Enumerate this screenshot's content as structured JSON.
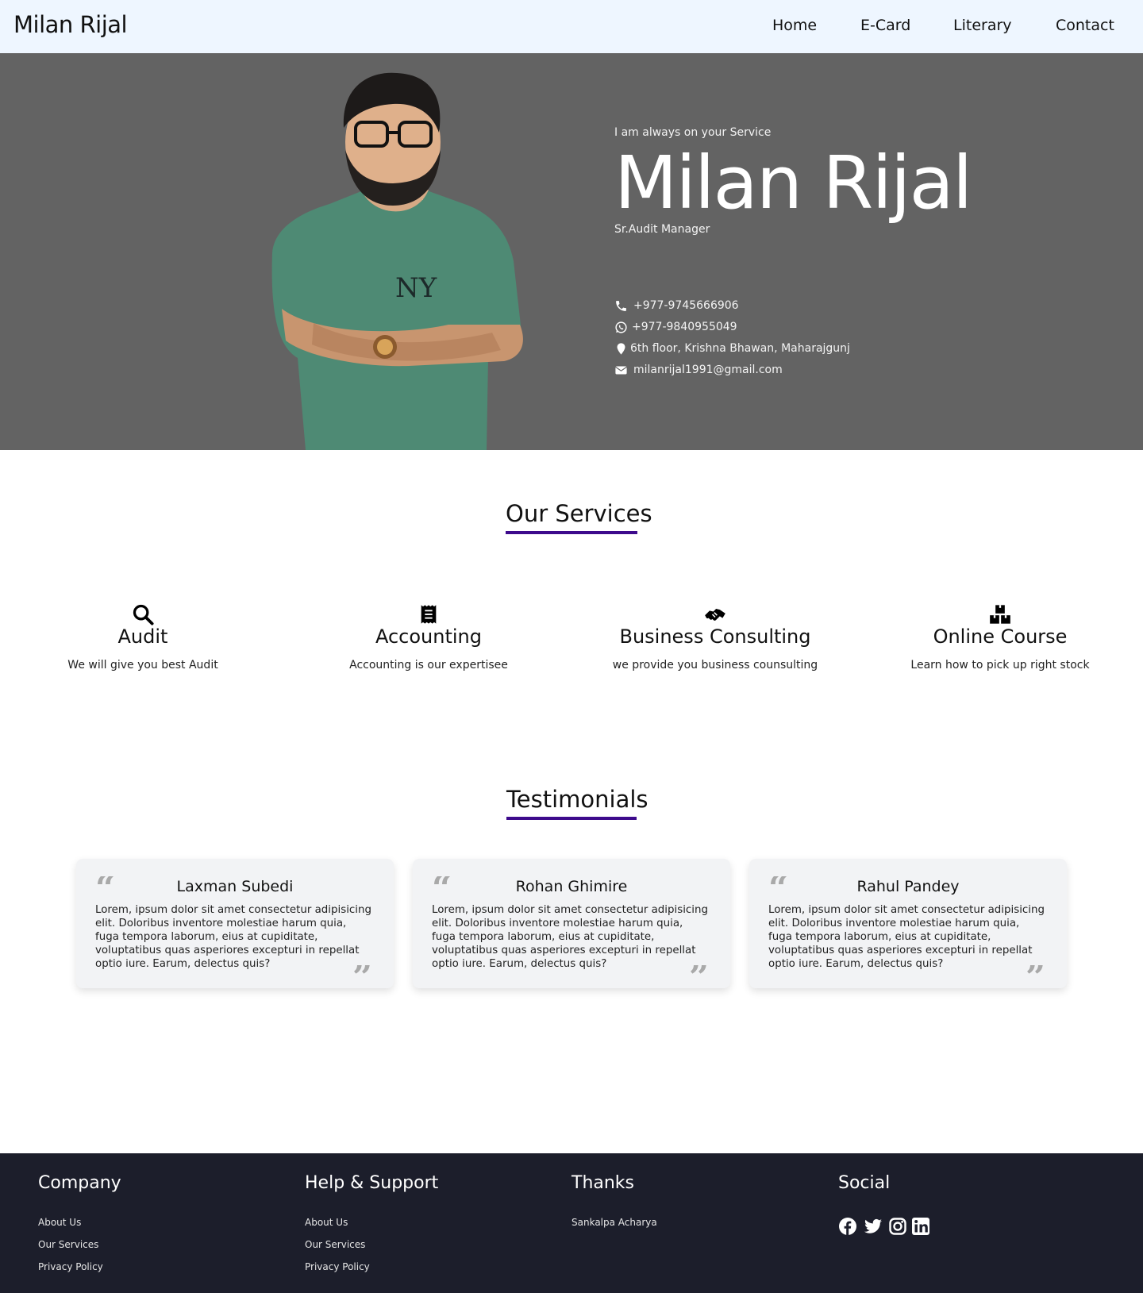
{
  "nav": {
    "brand": "Milan Rijal",
    "links": [
      "Home",
      "E-Card",
      "Literary",
      "Contact"
    ]
  },
  "hero": {
    "tagline": "I am always on your Service",
    "name": "Milan Rijal",
    "role": "Sr.Audit Manager",
    "contacts": [
      {
        "icon": "phone-icon",
        "text": "+977-9745666906"
      },
      {
        "icon": "whatsapp-icon",
        "text": "+977-9840955049"
      },
      {
        "icon": "location-pin-icon",
        "text": "6th floor, Krishna Bhawan, Maharajgunj"
      },
      {
        "icon": "envelope-icon",
        "text": "milanrijal1991@gmail.com"
      }
    ]
  },
  "services": {
    "title": "Our Services",
    "items": [
      {
        "icon": "search-icon",
        "title": "Audit",
        "desc": "We will give you best Audit"
      },
      {
        "icon": "receipt-icon",
        "title": "Accounting",
        "desc": "Accounting is our expertisee"
      },
      {
        "icon": "handshake-icon",
        "title": "Business Consulting",
        "desc": "we provide you business counsulting"
      },
      {
        "icon": "boxes-icon",
        "title": "Online Course",
        "desc": "Learn how to pick up right stock"
      }
    ]
  },
  "testimonials": {
    "title": "Testimonials",
    "items": [
      {
        "name": "Laxman Subedi",
        "text": "Lorem, ipsum dolor sit amet consectetur adipisicing elit. Doloribus inventore molestiae harum quia, fuga tempora laborum, eius at cupiditate, voluptatibus quas asperiores excepturi in repellat optio iure. Earum, delectus quis?"
      },
      {
        "name": "Rohan Ghimire",
        "text": "Lorem, ipsum dolor sit amet consectetur adipisicing elit. Doloribus inventore molestiae harum quia, fuga tempora laborum, eius at cupiditate, voluptatibus quas asperiores excepturi in repellat optio iure. Earum, delectus quis?"
      },
      {
        "name": "Rahul Pandey",
        "text": "Lorem, ipsum dolor sit amet consectetur adipisicing elit. Doloribus inventore molestiae harum quia, fuga tempora laborum, eius at cupiditate, voluptatibus quas asperiores excepturi in repellat optio iure. Earum, delectus quis?"
      }
    ]
  },
  "footer": {
    "company": {
      "title": "Company",
      "links": [
        "About Us",
        "Our Services",
        "Privacy Policy"
      ]
    },
    "help": {
      "title": "Help & Support",
      "links": [
        "About Us",
        "Our Services",
        "Privacy Policy"
      ]
    },
    "thanks": {
      "title": "Thanks",
      "links": [
        "Sankalpa Acharya"
      ]
    },
    "social": {
      "title": "Social",
      "icons": [
        "facebook-icon",
        "twitter-icon",
        "instagram-icon",
        "linkedin-icon"
      ]
    }
  },
  "colors": {
    "nav_bg": "#eef6ff",
    "hero_bg": "#636363",
    "accent_underline": "#3d0a8c",
    "card_bg": "#f2f3f5",
    "footer_bg": "#1c1e2b"
  }
}
